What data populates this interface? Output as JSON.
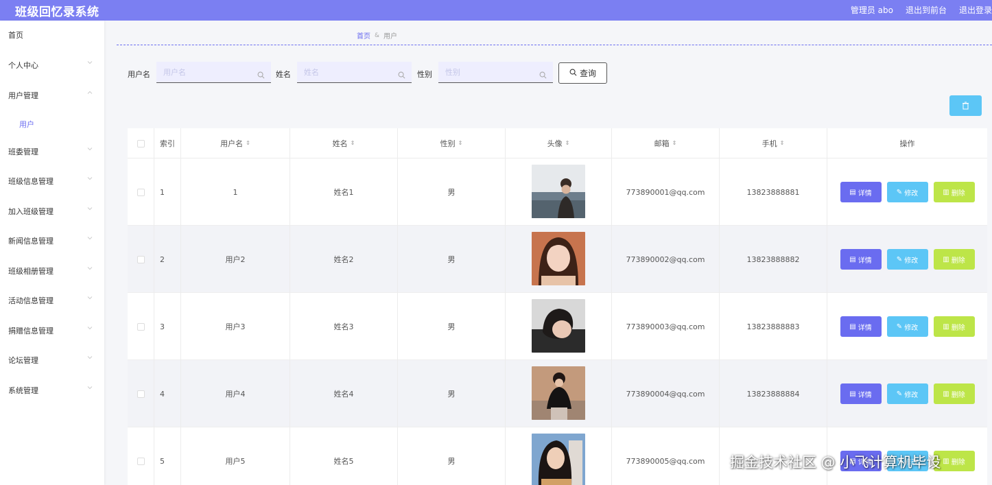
{
  "app": {
    "title": "班级回忆录系统"
  },
  "topbar": {
    "admin": "管理员 abo",
    "back_front": "退出到前台",
    "logout": "退出登录"
  },
  "sidebar": {
    "items": [
      {
        "label": "首页",
        "expanded": false,
        "has_arrow": false
      },
      {
        "label": "个人中心",
        "expanded": false,
        "has_arrow": true
      },
      {
        "label": "用户管理",
        "expanded": true,
        "has_arrow": true
      },
      {
        "label": "班委管理",
        "expanded": false,
        "has_arrow": true
      },
      {
        "label": "班级信息管理",
        "expanded": false,
        "has_arrow": true
      },
      {
        "label": "加入班级管理",
        "expanded": false,
        "has_arrow": true
      },
      {
        "label": "新闻信息管理",
        "expanded": false,
        "has_arrow": true
      },
      {
        "label": "班级相册管理",
        "expanded": false,
        "has_arrow": true
      },
      {
        "label": "活动信息管理",
        "expanded": false,
        "has_arrow": true
      },
      {
        "label": "捐赠信息管理",
        "expanded": false,
        "has_arrow": true
      },
      {
        "label": "论坛管理",
        "expanded": false,
        "has_arrow": true
      },
      {
        "label": "系统管理",
        "expanded": false,
        "has_arrow": true
      }
    ],
    "subitem": "用户"
  },
  "breadcrumb": {
    "home": "首页",
    "current": "用户"
  },
  "search": {
    "username_label": "用户名",
    "username_placeholder": "用户名",
    "name_label": "姓名",
    "name_placeholder": "姓名",
    "gender_label": "性别",
    "gender_placeholder": "性别",
    "query_label": "查询"
  },
  "table": {
    "headers": {
      "index": "索引",
      "username": "用户名",
      "name": "姓名",
      "gender": "性别",
      "avatar": "头像",
      "email": "邮箱",
      "phone": "手机",
      "actions": "操作"
    },
    "actions": {
      "detail": "详情",
      "edit": "修改",
      "delete": "删除"
    },
    "rows": [
      {
        "index": "1",
        "username": "1",
        "name": "姓名1",
        "gender": "男",
        "email": "773890001@qq.com",
        "phone": "13823888881"
      },
      {
        "index": "2",
        "username": "用户2",
        "name": "姓名2",
        "gender": "男",
        "email": "773890002@qq.com",
        "phone": "13823888882"
      },
      {
        "index": "3",
        "username": "用户3",
        "name": "姓名3",
        "gender": "男",
        "email": "773890003@qq.com",
        "phone": "13823888883"
      },
      {
        "index": "4",
        "username": "用户4",
        "name": "姓名4",
        "gender": "男",
        "email": "773890004@qq.com",
        "phone": "13823888884"
      },
      {
        "index": "5",
        "username": "用户5",
        "name": "姓名5",
        "gender": "男",
        "email": "773890005@qq.com",
        "phone": ""
      }
    ]
  },
  "watermark": "掘金技术社区 @ 小飞计算机毕设",
  "colors": {
    "accent": "#7b7ff2",
    "detail": "#6a6cf0",
    "edit": "#5cc6f6",
    "delete": "#bde548"
  }
}
